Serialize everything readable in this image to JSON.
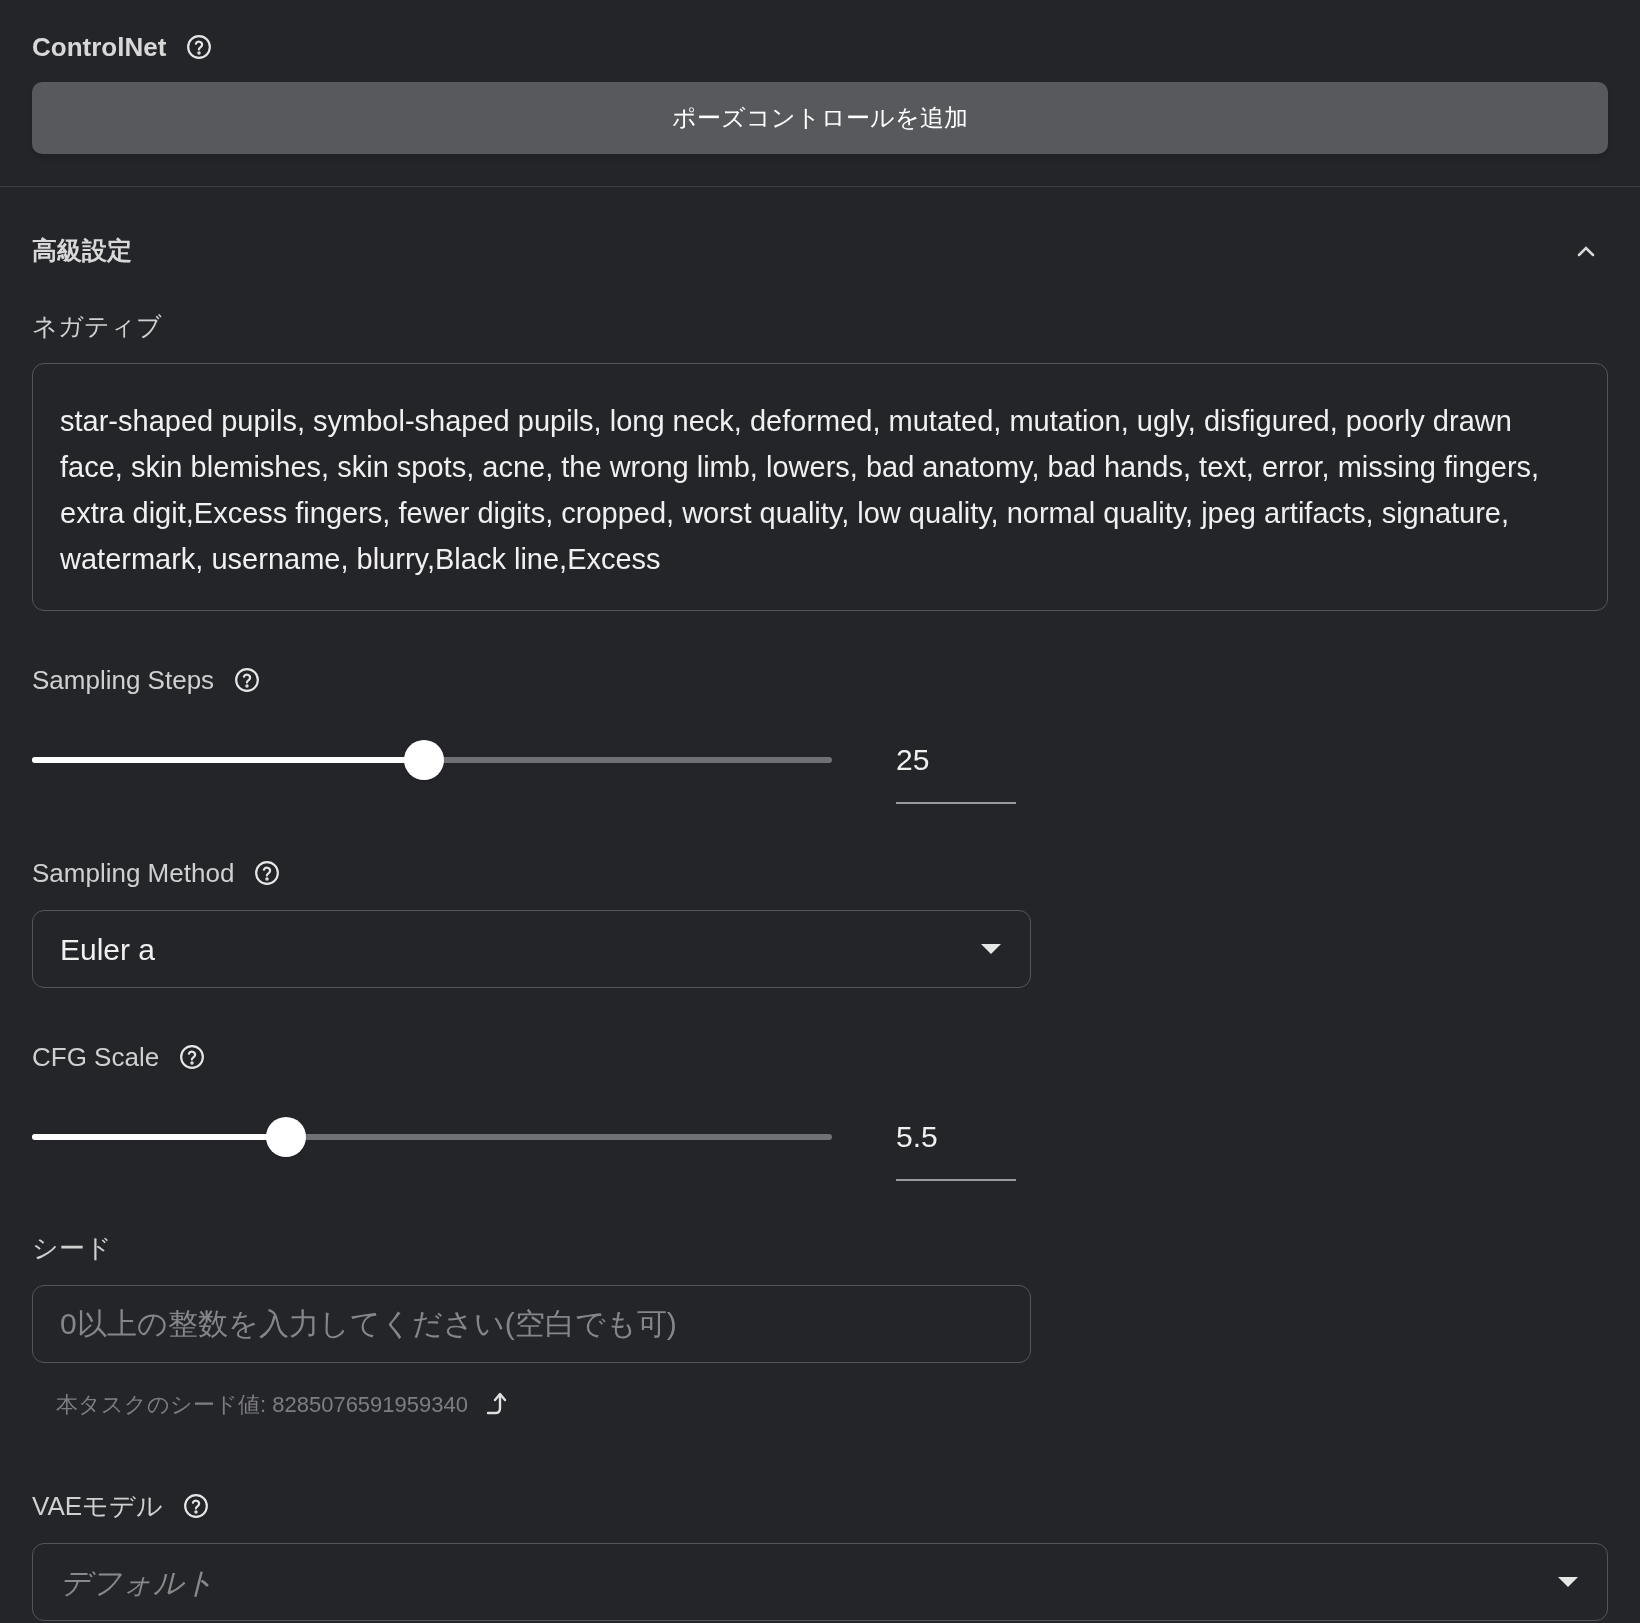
{
  "controlnet": {
    "label": "ControlNet",
    "button": "ポーズコントロールを追加"
  },
  "advanced": {
    "title": "高級設定",
    "expanded": true
  },
  "negative": {
    "label": "ネガティブ",
    "value": "star-shaped pupils, symbol-shaped pupils, long neck, deformed, mutated, mutation, ugly, disfigured, poorly drawn face, skin blemishes, skin spots, acne, the wrong limb, lowers, bad anatomy, bad hands, text, error, missing fingers, extra digit,Excess fingers, fewer digits, cropped, worst quality, low quality, normal quality, jpeg artifacts, signature, watermark, username, blurry,Black line,Excess"
  },
  "fields": [
    {
      "kind": "slider",
      "label": "Sampling Steps",
      "help": true,
      "level": 0.49,
      "value": "25"
    },
    {
      "kind": "select",
      "label": "Sampling Method",
      "help": true,
      "value": "Euler a"
    },
    {
      "kind": "slider",
      "label": "CFG Scale",
      "help": true,
      "level": 0.317,
      "value": "5.5"
    },
    {
      "kind": "input",
      "label": "シード",
      "help": false,
      "placeholder": "0以上の整数を入力してください(空白でも可)",
      "note": "本タスクのシード値: 8285076591959340"
    },
    {
      "kind": "select_wide",
      "label": "VAEモデル",
      "help": true,
      "placeholder": "デフォルト"
    }
  ]
}
